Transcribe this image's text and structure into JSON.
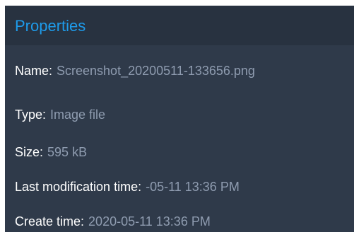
{
  "dialog": {
    "title": "Properties",
    "colors": {
      "title_text": "#1e9bea",
      "label_text": "#ffffff",
      "value_text": "#8f9cb0",
      "dialog_bg": "#2f3a4a",
      "title_bar_bg": "#283240"
    },
    "rows": [
      {
        "label": "Name:",
        "value": "Screenshot_20200511-133656.png"
      },
      {
        "label": "Type:",
        "value": "Image file"
      },
      {
        "label": "Size:",
        "value": "595 kB"
      },
      {
        "label": "Last modification time:",
        "value": "-05-11 13:36 PM"
      },
      {
        "label": "Create time:",
        "value": "2020-05-11 13:36 PM"
      }
    ]
  }
}
